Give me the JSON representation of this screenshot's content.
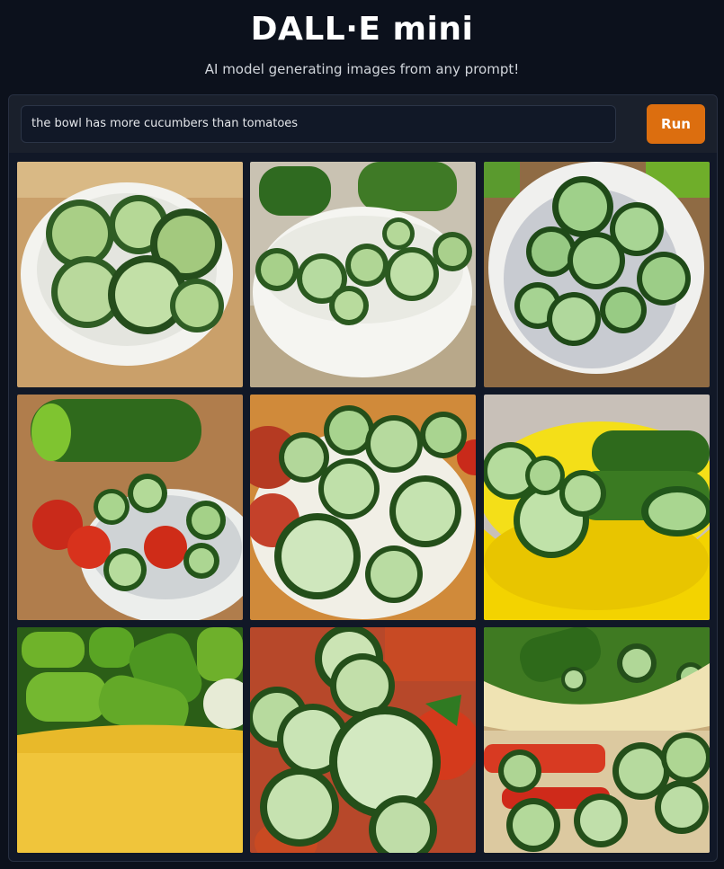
{
  "header": {
    "title": "DALL·E mini",
    "subtitle": "AI model generating images from any prompt!"
  },
  "prompt": {
    "value": "the bowl has more cucumbers than tomatoes",
    "run_label": "Run"
  },
  "gallery": {
    "images": [
      {
        "name": "generated-image-1",
        "scene": "white bowl with cucumber slices on wood"
      },
      {
        "name": "generated-image-2",
        "scene": "white bowl with cucumber slices and whole cucumbers"
      },
      {
        "name": "generated-image-3",
        "scene": "white bowl with cucumber slices, close up"
      },
      {
        "name": "generated-image-4",
        "scene": "cucumber slices and tomatoes in bowl with whole cucumber"
      },
      {
        "name": "generated-image-5",
        "scene": "large cucumber slices in bowl with tomatoes"
      },
      {
        "name": "generated-image-6",
        "scene": "yellow bowl with cucumbers and slices"
      },
      {
        "name": "generated-image-7",
        "scene": "yellow bowl full of whole cucumbers"
      },
      {
        "name": "generated-image-8",
        "scene": "cucumber slices with tomatoes close up"
      },
      {
        "name": "generated-image-9",
        "scene": "bowl of cucumbers with red pepper strips"
      }
    ]
  }
}
